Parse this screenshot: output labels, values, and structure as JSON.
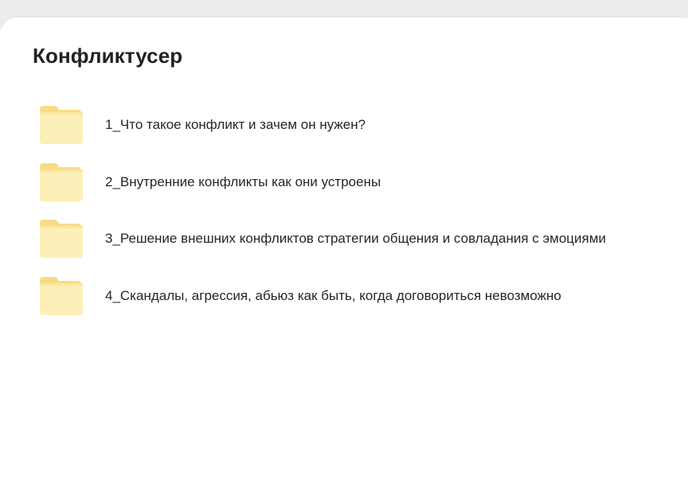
{
  "folder": {
    "title": "Конфликтусер",
    "items": [
      {
        "label": "1_Что такое конфликт и зачем он нужен?"
      },
      {
        "label": "2_Внутренние конфликты как они устроены"
      },
      {
        "label": "3_Решение внешних конфликтов стратегии общения и совладания с эмоциями"
      },
      {
        "label": "4_Скандалы, агрессия, абьюз как быть, когда договориться невозможно"
      }
    ]
  },
  "icons": {
    "item_icon": "folder-icon"
  },
  "colors": {
    "folder_back": "#fbe7a2",
    "folder_front": "#fdefb8",
    "title_text": "#222222",
    "item_text": "#262626",
    "top_strip": "#ececef"
  }
}
